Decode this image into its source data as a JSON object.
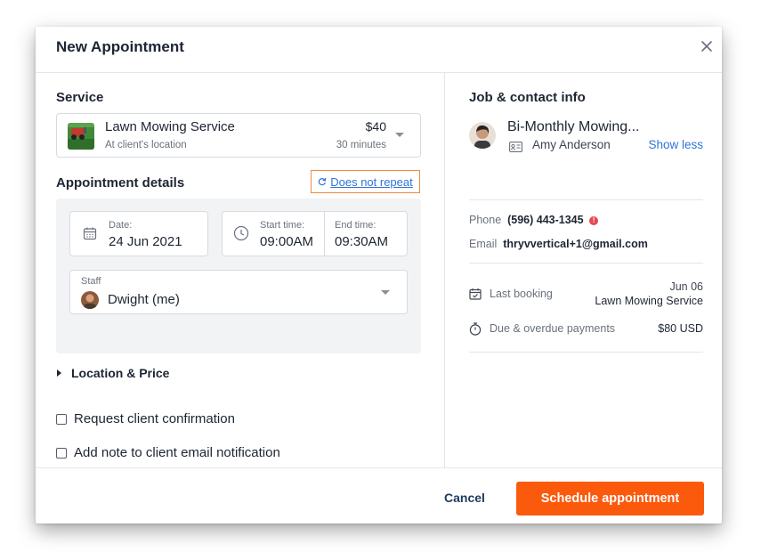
{
  "modal": {
    "title": "New Appointment",
    "close_icon": "close-icon"
  },
  "service": {
    "section_label": "Service",
    "name": "Lawn Mowing Service",
    "location": "At client's location",
    "price": "$40",
    "duration": "30 minutes"
  },
  "appointment": {
    "section_label": "Appointment details",
    "repeat_label": "Does not repeat",
    "date_label": "Date:",
    "date_value": "24 Jun 2021",
    "start_label": "Start time:",
    "start_value": "09:00AM",
    "end_label": "End time:",
    "end_value": "09:30AM",
    "staff_label": "Staff",
    "staff_value": "Dwight (me)"
  },
  "location_price": {
    "label": "Location & Price"
  },
  "options": {
    "request_confirmation": "Request client confirmation",
    "add_note": "Add note to client email notification"
  },
  "contact": {
    "section_label": "Job & contact info",
    "job_title": "Bi-Monthly Mowing...",
    "client_name": "Amy Anderson",
    "show_less": "Show less",
    "phone_label": "Phone",
    "phone_value": "(596) 443-1345",
    "email_label": "Email",
    "email_value": "thryvvertical+1@gmail.com",
    "last_booking_label": "Last booking",
    "last_booking_date": "Jun 06",
    "last_booking_service": "Lawn Mowing Service",
    "due_label": "Due & overdue payments",
    "due_value": "$80 USD"
  },
  "footer": {
    "cancel_label": "Cancel",
    "schedule_label": "Schedule appointment"
  },
  "colors": {
    "primary": "#fb5a0d",
    "link": "#2f74d9",
    "highlight_border": "#ee8a3f",
    "warning": "#e5484d"
  }
}
